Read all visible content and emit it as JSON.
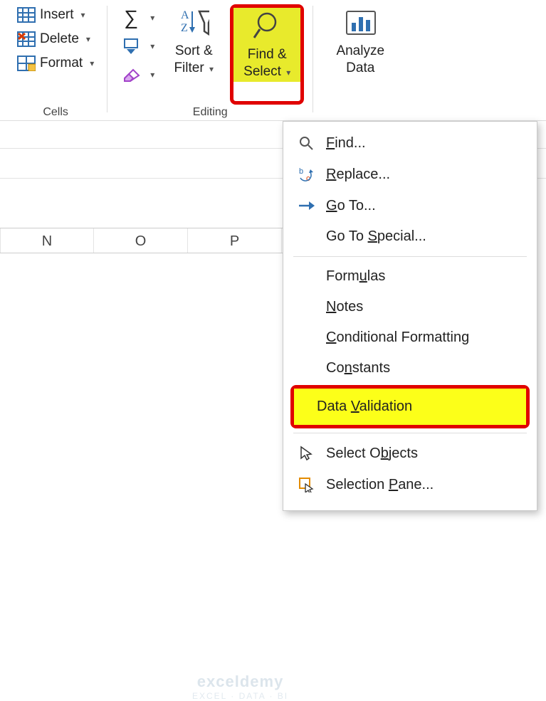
{
  "ribbon": {
    "cells": {
      "label": "Cells",
      "insert": "Insert",
      "delete": "Delete",
      "format": "Format"
    },
    "editing": {
      "label": "Editing",
      "sort_filter_l1": "Sort &",
      "sort_filter_l2": "Filter",
      "find_select_l1": "Find &",
      "find_select_l2": "Select"
    },
    "analysis": {
      "l1": "Analyze",
      "l2": "Data"
    }
  },
  "columns": {
    "n": "N",
    "o": "O",
    "p": "P"
  },
  "menu": {
    "find": "Find...",
    "replace": "Replace...",
    "goto": "Go To...",
    "goto_special": "Go To Special...",
    "formulas": "Formulas",
    "notes": "Notes",
    "cond_fmt": "Conditional Formatting",
    "constants": "Constants",
    "data_validation": "Data Validation",
    "select_objects": "Select Objects",
    "selection_pane": "Selection Pane..."
  },
  "watermark": {
    "brand": "exceldemy",
    "sub": "EXCEL · DATA · BI"
  }
}
